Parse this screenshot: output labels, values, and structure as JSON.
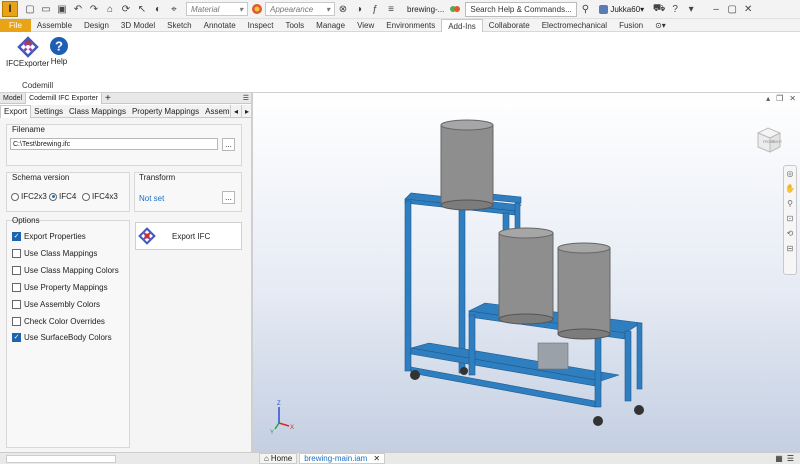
{
  "qat": {
    "app_letter": "I",
    "material_placeholder": "Material",
    "appearance_placeholder": "Appearance",
    "doc_title": "brewing-...",
    "search_placeholder": "Search Help & Commands...",
    "user_name": "Jukka60"
  },
  "tabs": [
    "File",
    "Assemble",
    "Design",
    "3D Model",
    "Sketch",
    "Annotate",
    "Inspect",
    "Tools",
    "Manage",
    "View",
    "Environments",
    "Add-Ins",
    "Collaborate",
    "Electromechanical",
    "Fusion"
  ],
  "ribbon": {
    "ifc_exporter_label": "IFCExporter",
    "help_label": "Help",
    "panel_label": "Codemill"
  },
  "browser": {
    "model_tab": "Model",
    "plugin_tab": "Codemill IFC Exporter",
    "add_tab": "+",
    "subtabs": [
      "Export",
      "Settings",
      "Class Mappings",
      "Property Mappings",
      "Assembl"
    ]
  },
  "export": {
    "filename_title": "Filename",
    "filename_value": "C:\\Test\\brewing.ifc",
    "browse_label": "...",
    "schema_title": "Schema version",
    "schemas": [
      {
        "label": "IFC2x3",
        "selected": false
      },
      {
        "label": "IFC4",
        "selected": true
      },
      {
        "label": "IFC4x3",
        "selected": false
      }
    ],
    "transform_title": "Transform",
    "transform_value": "Not set",
    "options_title": "Options",
    "options": [
      {
        "label": "Export Properties",
        "checked": true
      },
      {
        "label": "Use Class Mappings",
        "checked": false
      },
      {
        "label": "Use Class Mapping Colors",
        "checked": false
      },
      {
        "label": "Use Property Mappings",
        "checked": false
      },
      {
        "label": "Use Assembly Colors",
        "checked": false
      },
      {
        "label": "Check Color Overrides",
        "checked": false
      },
      {
        "label": "Use SurfaceBody Colors",
        "checked": true
      }
    ],
    "export_button": "Export IFC"
  },
  "viewcube": {
    "front": "FRONT",
    "right": "RIGHT"
  },
  "triad": {
    "x": "X",
    "y": "Y",
    "z": "Z"
  },
  "statusbar": {
    "home_tab": "Home",
    "doc_tab": "brewing-main.iam"
  },
  "colors": {
    "accent": "#e8a317",
    "frame": "#2f7ec0",
    "tank": "#8e8e8e",
    "link": "#1a6fc4"
  }
}
